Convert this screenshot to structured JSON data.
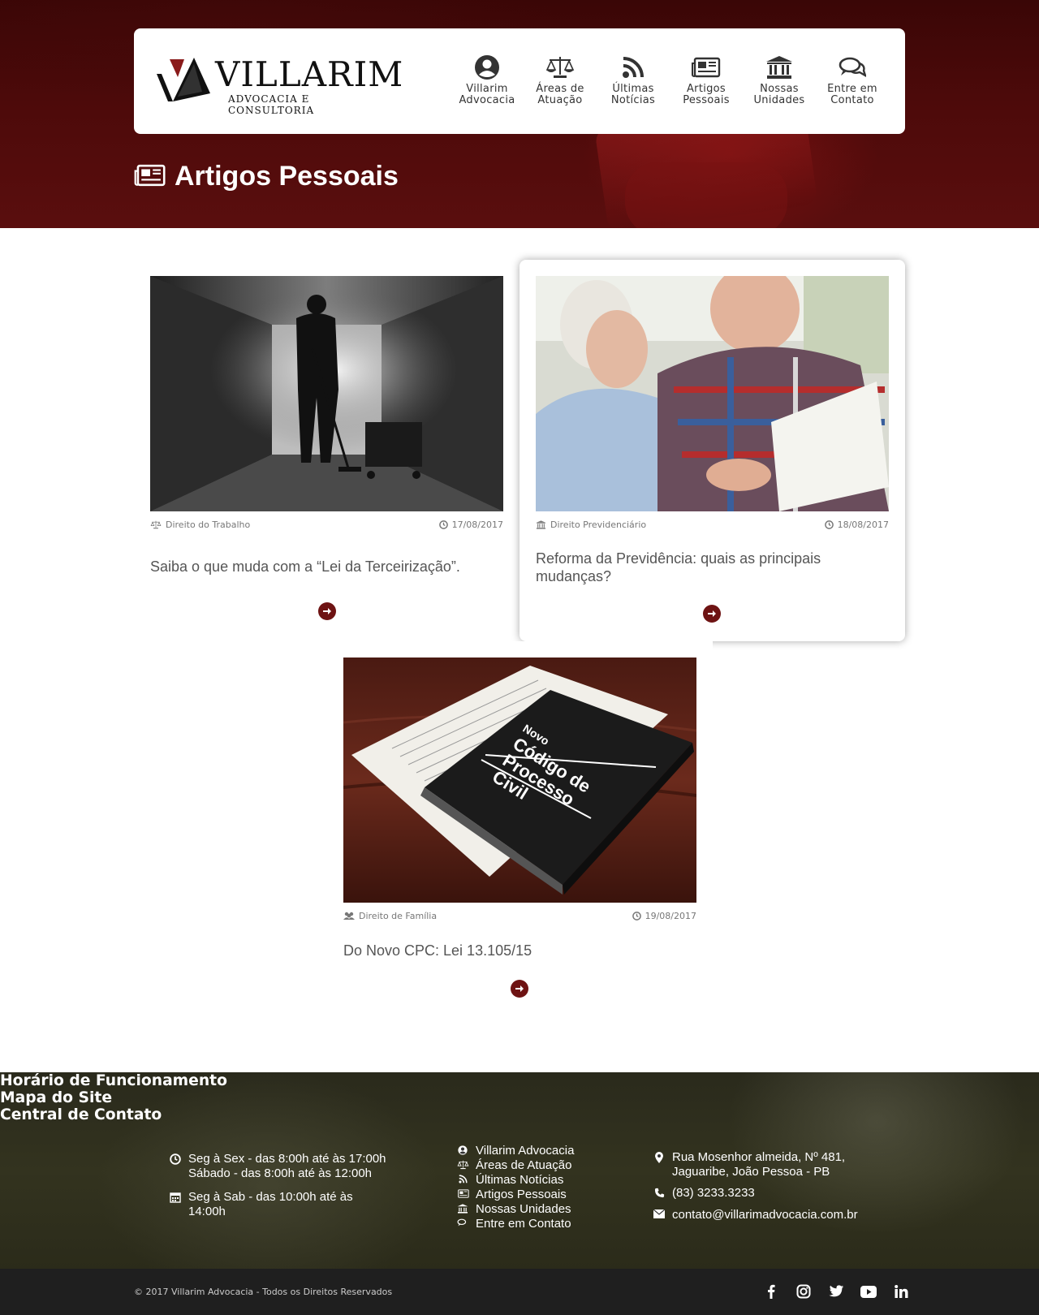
{
  "brand": {
    "name": "VILLARIM",
    "tagline": "ADVOCACIA E CONSULTORIA"
  },
  "nav": [
    {
      "label": "Villarim\nAdvocacia",
      "icon": "user-circle-icon"
    },
    {
      "label": "Áreas de\nAtuação",
      "icon": "balance-scale-icon"
    },
    {
      "label": "Últimas\nNotícias",
      "icon": "rss-icon"
    },
    {
      "label": "Artigos\nPessoais",
      "icon": "newspaper-icon"
    },
    {
      "label": "Nossas\nUnidades",
      "icon": "institution-icon"
    },
    {
      "label": "Entre em\nContato",
      "icon": "comments-icon"
    }
  ],
  "page": {
    "title": "Artigos Pessoais"
  },
  "articles": [
    {
      "category": "Direito do Trabalho",
      "date": "17/08/2017",
      "title": "Saiba o que muda com a “Lei da Terceirização”."
    },
    {
      "category": "Direito Previdenciário",
      "date": "18/08/2017",
      "title": "Reforma da Previdência: quais as principais mudanças?"
    },
    {
      "category": "Direito de Família",
      "date": "19/08/2017",
      "title": "Do Novo CPC: Lei 13.105/15",
      "image_text": [
        "Novo",
        "Código de",
        "Processo",
        "Civil"
      ]
    }
  ],
  "footer": {
    "hours": {
      "title": "Horário de Funcionamento",
      "line1": "Seg à Sex - das 8:00h até às 17:00h",
      "line2": "Sábado - das 8:00h até às 12:00h",
      "line3": "Seg à Sab - das 10:00h até às",
      "line4": "14:00h"
    },
    "sitemap": {
      "title": "Mapa do Site",
      "items": [
        "Villarim Advocacia",
        "Áreas de Atuação",
        "Últimas Notícias",
        "Artigos Pessoais",
        "Nossas Unidades",
        "Entre em Contato"
      ]
    },
    "contact": {
      "title": "Central de Contato",
      "address1": "Rua Mosenhor almeida, Nº 481,",
      "address2": "Jaguaribe, João Pessoa - PB",
      "phone": "(83) 3233.3233",
      "email": "contato@villarimadvocacia.com.br"
    },
    "copyright": "© 2017 Villarim Advocacia - Todos os Direitos Reservados",
    "social": [
      "facebook-icon",
      "instagram-icon",
      "twitter-icon",
      "youtube-icon",
      "linkedin-icon"
    ]
  },
  "colors": {
    "accent": "#6e1313",
    "hero": "#4d0a0a",
    "footer": "#33331f"
  }
}
